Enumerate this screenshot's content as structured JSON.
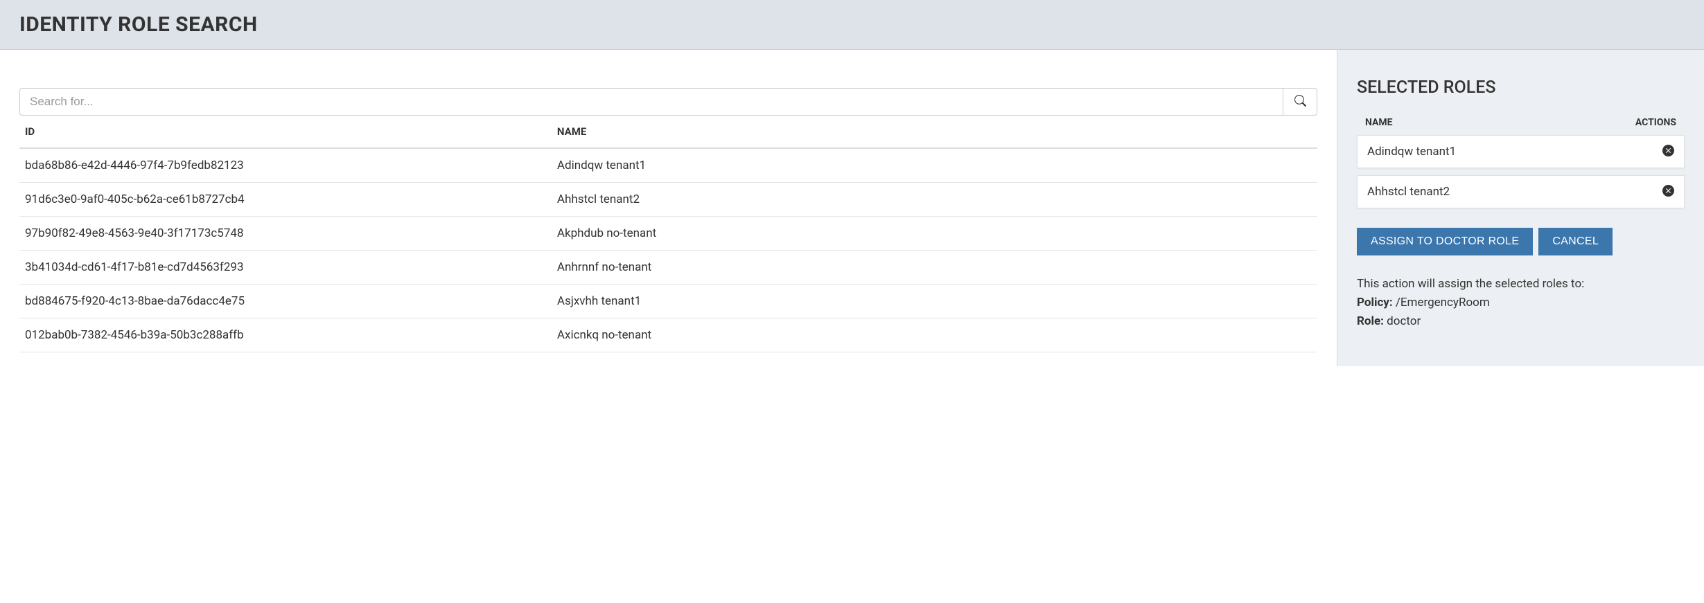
{
  "header": {
    "title": "IDENTITY ROLE SEARCH"
  },
  "search": {
    "placeholder": "Search for..."
  },
  "table": {
    "headers": {
      "id": "ID",
      "name": "NAME"
    },
    "rows": [
      {
        "id": "bda68b86-e42d-4446-97f4-7b9fedb82123",
        "name": "Adindqw tenant1"
      },
      {
        "id": "91d6c3e0-9af0-405c-b62a-ce61b8727cb4",
        "name": "Ahhstcl tenant2"
      },
      {
        "id": "97b90f82-49e8-4563-9e40-3f17173c5748",
        "name": "Akphdub no-tenant"
      },
      {
        "id": "3b41034d-cd61-4f17-b81e-cd7d4563f293",
        "name": "Anhrnnf no-tenant"
      },
      {
        "id": "bd884675-f920-4c13-8bae-da76dacc4e75",
        "name": "Asjxvhh tenant1"
      },
      {
        "id": "012bab0b-7382-4546-b39a-50b3c288affb",
        "name": "Axicnkq no-tenant"
      }
    ]
  },
  "selected": {
    "title": "SELECTED ROLES",
    "headers": {
      "name": "NAME",
      "actions": "ACTIONS"
    },
    "items": [
      {
        "name": "Adindqw tenant1"
      },
      {
        "name": "Ahhstcl tenant2"
      }
    ]
  },
  "actions": {
    "assign": "ASSIGN TO DOCTOR ROLE",
    "cancel": "CANCEL"
  },
  "info": {
    "lead": "This action will assign the selected roles to:",
    "policy_label": "Policy:",
    "policy_value": " /EmergencyRoom",
    "role_label": "Role:",
    "role_value": " doctor"
  }
}
